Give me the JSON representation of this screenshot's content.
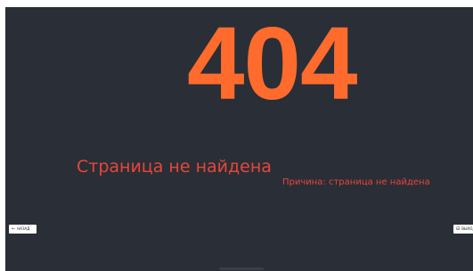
{
  "error": {
    "code": "404",
    "title": "Страница не найдена",
    "reason": "Причина: страница не найдена"
  },
  "nav": {
    "back_label": "НАЗАД",
    "back_icon": "arrow-left-icon",
    "exit_label": "ВЫХОД",
    "exit_icon": "exit-icon"
  },
  "colors": {
    "background": "#2a2e36",
    "code": "#ff6b2c",
    "message": "#e8463a"
  }
}
